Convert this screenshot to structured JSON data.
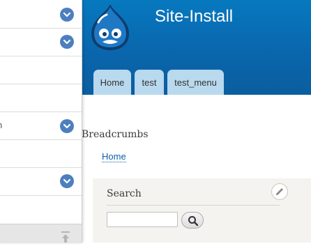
{
  "toolbar_tray": {
    "items": [
      {
        "label": ""
      },
      {
        "label": ""
      },
      {
        "label": ""
      },
      {
        "label": ""
      },
      {
        "label": "n"
      },
      {
        "label": ""
      },
      {
        "label": ""
      },
      {
        "label": ""
      }
    ],
    "toggle_icon": "chevron-down-icon",
    "footer_icon": "arrow-up-icon",
    "accent_color": "#4d7fbf"
  },
  "header": {
    "site_name": "Site-Install",
    "logo": "drupal-drop-logo",
    "background_color": "#0a66ad",
    "tabs": [
      {
        "label": "Home"
      },
      {
        "label": "test"
      },
      {
        "label": "test_menu"
      }
    ],
    "tab_color": "#b9d9ee"
  },
  "breadcrumbs": {
    "title": "Breadcrumbs",
    "links": [
      {
        "label": "Home"
      }
    ]
  },
  "search_block": {
    "title": "Search",
    "input_value": "",
    "button_icon": "magnifier-icon",
    "edit_icon": "pencil-icon"
  }
}
